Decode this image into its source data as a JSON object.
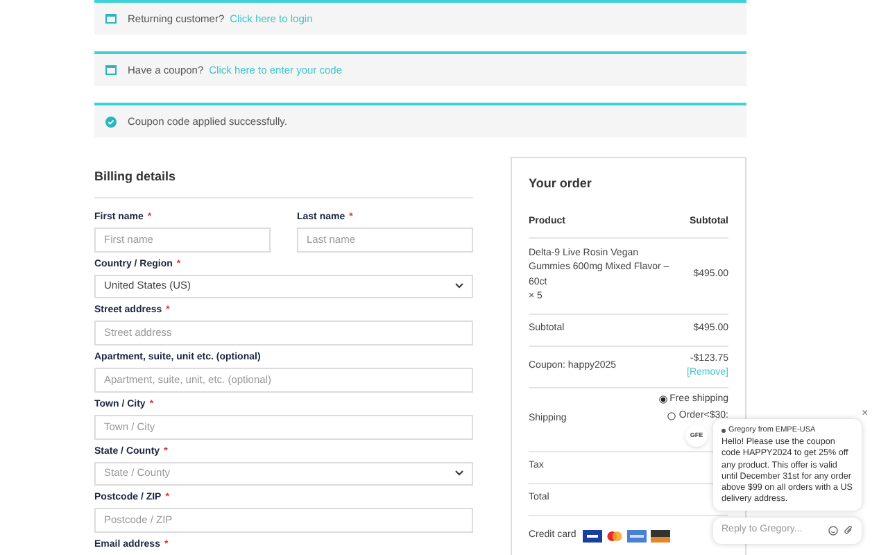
{
  "notices": [
    {
      "kind": "info",
      "text": "Returning customer?",
      "link": "Click here to login"
    },
    {
      "kind": "info",
      "text": "Have a coupon?",
      "link": "Click here to enter your code"
    },
    {
      "kind": "success",
      "text": "Coupon code applied successfully."
    }
  ],
  "billing": {
    "title": "Billing details",
    "name_row": [
      {
        "kind": "input",
        "label": "First name",
        "required_mark": "*",
        "placeholder": "First name"
      },
      {
        "kind": "input",
        "label": "Last name",
        "required_mark": "*",
        "placeholder": "Last name"
      }
    ],
    "fields": [
      {
        "kind": "select",
        "label": "Country / Region",
        "required_mark": "*",
        "value": "United States (US)"
      },
      {
        "kind": "input",
        "label": "Street address",
        "required_mark": "*",
        "placeholder": "Street address"
      },
      {
        "kind": "input",
        "label": "Apartment, suite, unit etc. (optional)",
        "placeholder": "Apartment, suite, unit, etc. (optional)"
      },
      {
        "kind": "input",
        "label": "Town / City",
        "required_mark": "*",
        "placeholder": "Town / City"
      },
      {
        "kind": "select",
        "label": "State / County",
        "required_mark": "*",
        "placeholder": "State / County"
      },
      {
        "kind": "input",
        "label": "Postcode / ZIP",
        "required_mark": "*",
        "placeholder": "Postcode / ZIP"
      },
      {
        "kind": "label",
        "label": "Email address",
        "required_mark": "*"
      }
    ]
  },
  "order": {
    "title": "Your order",
    "columns": [
      "Product",
      "Subtotal"
    ],
    "item": {
      "name": "Delta-9 Live Rosin Vegan Gummies 600mg Mixed Flavor – 60ct",
      "qty": "× 5",
      "price": "$495.00"
    },
    "subtotal": {
      "label": "Subtotal",
      "value": "$495.00"
    },
    "coupon": {
      "label": "Coupon: happy2025",
      "value": "-$123.75",
      "remove": "[Remove]"
    },
    "shipping": {
      "label": "Shipping",
      "options": [
        {
          "label": "Free shipping",
          "selected": true
        },
        {
          "label": "Order<$30:",
          "selected": false
        }
      ]
    },
    "tax": {
      "label": "Tax"
    },
    "total": {
      "label": "Total"
    },
    "payment": {
      "label": "Credit card"
    }
  },
  "chat": {
    "avatar": "GFE",
    "sender": "Gregory from EMPE-USA",
    "message": "Hello! Please use the coupon code HAPPY2024 to get 25% off any product. This offer is valid until December 31st for any order above $99 on all orders with a US delivery address.",
    "reply_placeholder": "Reply to Gregory...",
    "close": "×"
  }
}
